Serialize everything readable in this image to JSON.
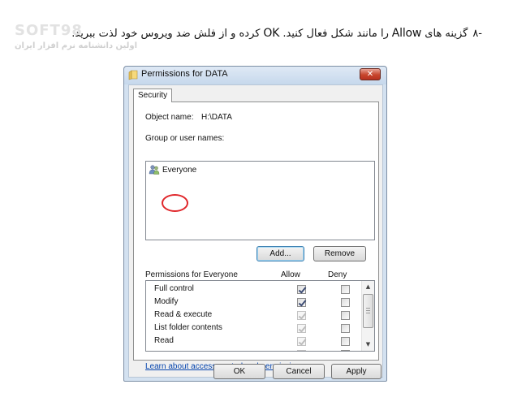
{
  "caption": {
    "number": "-۸",
    "text_part1": "گزینه های ",
    "allow_word": "Allow",
    "text_part2": " را مانند شکل فعال کنید. ",
    "ok_word": "OK",
    "text_part3": " کرده و از فلش ضد ویروس خود لذت ببرید."
  },
  "watermark": {
    "brand": "SOFT98",
    "subtitle": "اولین دانشنامه نرم افزار ایران"
  },
  "window": {
    "title": "Permissions for DATA",
    "close_label": "✕",
    "tab_label": "Security",
    "object_name_label": "Object name:",
    "object_name_value": "H:\\DATA",
    "group_label": "Group or user names:",
    "users": [
      {
        "name": "Everyone",
        "icon": "users-icon"
      }
    ],
    "add_button": "Add...",
    "remove_button": "Remove",
    "permissions_header": "Permissions for Everyone",
    "allow_header": "Allow",
    "deny_header": "Deny",
    "permissions": [
      {
        "name": "Full control",
        "allow": true,
        "deny": false
      },
      {
        "name": "Modify",
        "allow": true,
        "deny": false
      },
      {
        "name": "Read & execute",
        "allow": true,
        "deny": false
      },
      {
        "name": "List folder contents",
        "allow": true,
        "deny": false
      },
      {
        "name": "Read",
        "allow": true,
        "deny": false
      }
    ],
    "link_text": "Learn about access control and permissions",
    "ok_button": "OK",
    "cancel_button": "Cancel",
    "apply_button": "Apply"
  },
  "colors": {
    "highlight_circle": "#e0262a",
    "link": "#0645ad",
    "frame": "#d3e1f0"
  }
}
